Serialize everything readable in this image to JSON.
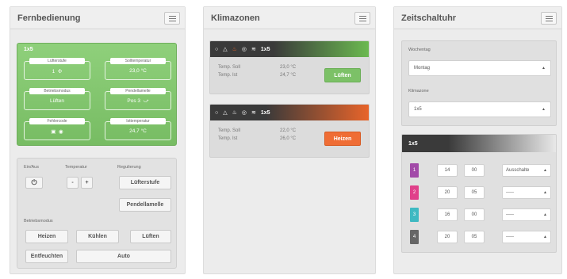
{
  "remote": {
    "title": "Fernbedienung",
    "zone_label": "1x5",
    "cells": [
      {
        "caption": "Lüfterstufe",
        "value": "1"
      },
      {
        "caption": "Solltemperatur",
        "value": "23,0 °C"
      },
      {
        "caption": "Betriebsmodus",
        "value": "Lüften"
      },
      {
        "caption": "Pendellamelle",
        "value": "Pos 3"
      },
      {
        "caption": "Fehlercode",
        "value": ""
      },
      {
        "caption": "Isttemperatur",
        "value": "24,7 °C"
      }
    ],
    "labels": {
      "power": "Ein/Aus",
      "temperature": "Temperatur",
      "regulation": "Regulierung",
      "modes": "Betriebsmodus"
    },
    "buttons": {
      "minus": "-",
      "plus": "+",
      "fan_level": "Lüfterstufe",
      "swing": "Pendellamelle",
      "heat": "Heizen",
      "cool": "Kühlen",
      "vent": "Lüften",
      "dry": "Entfeuchten",
      "auto": "Auto"
    }
  },
  "climate": {
    "title": "Klimazonen",
    "zones": [
      {
        "name": "1x5",
        "target_label": "Temp. Soll",
        "target": "23,0 °C",
        "actual_label": "Temp. Ist",
        "actual": "24,7 °C",
        "mode": "Lüften",
        "color": "#6bb950"
      },
      {
        "name": "1x5",
        "target_label": "Temp. Soll",
        "target": "22,0 °C",
        "actual_label": "Temp. Ist",
        "actual": "26,0 °C",
        "mode": "Heizen",
        "color": "#e8642a"
      }
    ]
  },
  "timer": {
    "title": "Zeitschaltuhr",
    "weekday_label": "Wochentag",
    "weekday_value": "Montag",
    "zone_label": "Klimazone",
    "zone_value": "1x5",
    "table_title": "1x5",
    "rows": [
      {
        "num": "1",
        "color": "#a24aa8",
        "hour": "14",
        "minute": "00",
        "action": "Ausschalte"
      },
      {
        "num": "2",
        "color": "#e0408a",
        "hour": "20",
        "minute": "05",
        "action": "-----"
      },
      {
        "num": "3",
        "color": "#3fb9c2",
        "hour": "16",
        "minute": "00",
        "action": "-----"
      },
      {
        "num": "4",
        "color": "#666666",
        "hour": "20",
        "minute": "05",
        "action": "-----"
      }
    ]
  },
  "colors": {
    "green": "#7cc167",
    "orange": "#e8642a"
  }
}
